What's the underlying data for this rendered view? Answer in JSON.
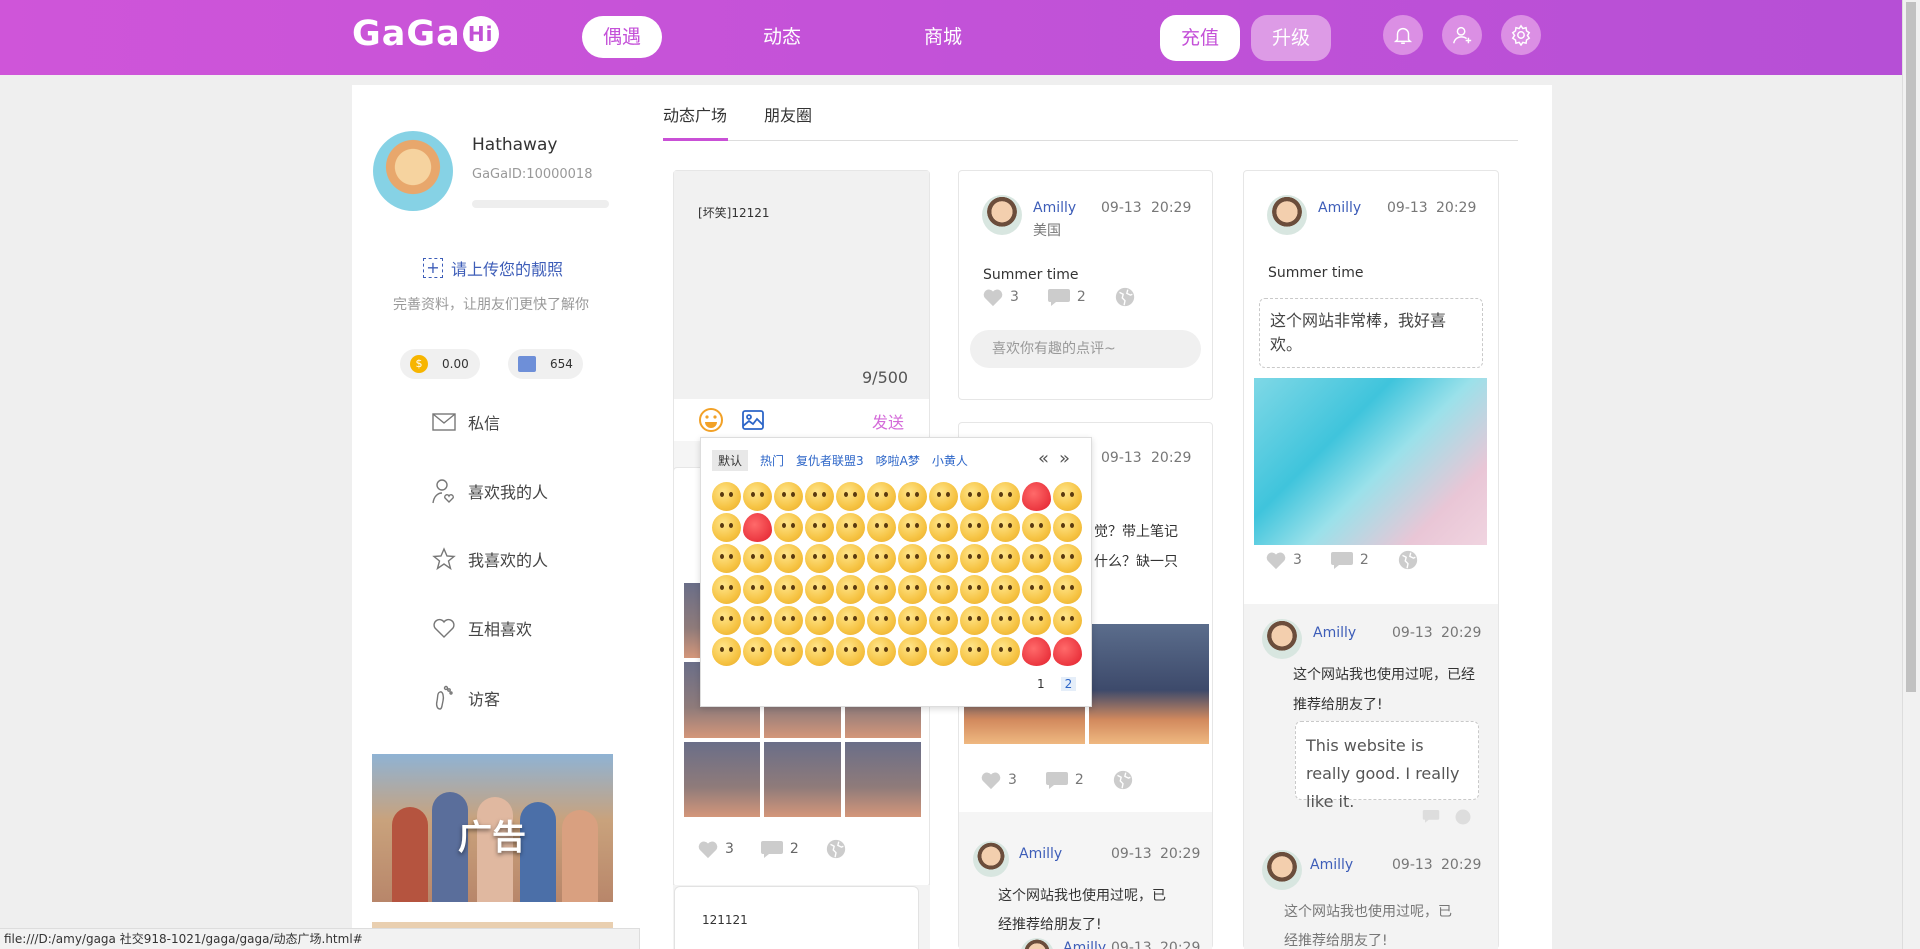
{
  "header": {
    "logo_text": "GaGa",
    "logo_badge": "Hi",
    "nav": [
      "偶遇",
      "动态",
      "商城"
    ],
    "charge_label": "充值",
    "upgrade_label": "升级",
    "icons": [
      "bell-icon",
      "user-icon",
      "gear-icon"
    ],
    "accent": "#c450d8"
  },
  "profile": {
    "name": "Hathaway",
    "id": "GaGaID:10000018",
    "upload_label": "请上传您的靓照",
    "complete_hint": "完善资料，让朋友们更快了解你",
    "coins": "0.00",
    "gems": "654",
    "menu": [
      "私信",
      "喜欢我的人",
      "我喜欢的人",
      "互相喜欢",
      "访客"
    ],
    "ad_label": "广告"
  },
  "tabs": [
    "动态广场",
    "朋友圈"
  ],
  "composer": {
    "text": "[坏笑]12121",
    "count": "9/500",
    "send_label": "发送",
    "post_likes": "3",
    "post_comments": "2",
    "next_text": "121121"
  },
  "emoji_panel": {
    "tabs": [
      "默认",
      "热门",
      "复仇者联盟3",
      "哆啦A梦",
      "小黄人"
    ],
    "prev": "«",
    "next": "»",
    "pages": [
      "1",
      "2"
    ]
  },
  "feed2": {
    "post1": {
      "name": "Amilly",
      "date": "09-13",
      "time": "20:29",
      "location": "美国",
      "text": "Summer time",
      "likes": "3",
      "comments": "2",
      "comment_placeholder": "喜欢你有趣的点评~"
    },
    "post2": {
      "date": "09-13",
      "time": "20:29",
      "text_line1": "觉？带上笔记",
      "text_line2": "什么？缺一只",
      "likes": "3",
      "comments": "2"
    },
    "comment": {
      "name": "Amilly",
      "date": "09-13",
      "time": "20:29",
      "text_line1": "这个网站我也使用过呢，已",
      "text_line2": "经推荐给朋友了!",
      "sub_name": "Amilly",
      "sub_date": "09-13",
      "sub_time": "20:29"
    }
  },
  "feed3": {
    "post": {
      "name": "Amilly",
      "date": "09-13",
      "time": "20:29",
      "text": "Summer time",
      "bubble": "这个网站非常棒，我好喜欢。",
      "likes": "3",
      "comments": "2"
    },
    "comment1": {
      "name": "Amilly",
      "date": "09-13",
      "time": "20:29",
      "text_line1": "这个网站我也使用过呢，已经",
      "text_line2": "推荐给朋友了!",
      "reply": "This website is really good. I really like it."
    },
    "comment2": {
      "name": "Amilly",
      "date": "09-13",
      "time": "20:29",
      "text_line1": "这个网站我也使用过呢，已",
      "text_line2": "经推荐给朋友了!"
    }
  },
  "status_url": "file:///D:/amy/gaga 社交918-1021/gaga/gaga/动态广场.html#"
}
